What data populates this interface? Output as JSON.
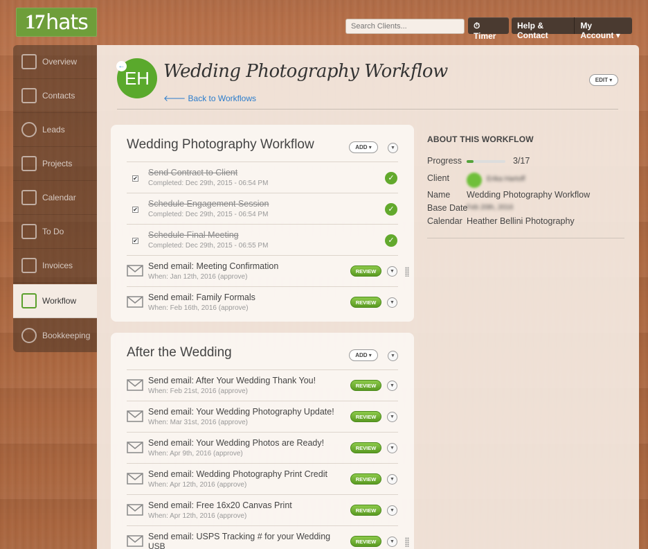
{
  "brand": {
    "logo_num": "17",
    "logo_text": "hats"
  },
  "header": {
    "search_placeholder": "Search Clients...",
    "timer_label": "Timer",
    "help_label": "Help & Contact",
    "account_label": "My Account"
  },
  "sidebar": {
    "items": [
      {
        "label": "Overview",
        "icon": "chart-icon"
      },
      {
        "label": "Contacts",
        "icon": "contacts-icon"
      },
      {
        "label": "Leads",
        "icon": "lead-icon"
      },
      {
        "label": "Projects",
        "icon": "projects-icon"
      },
      {
        "label": "Calendar",
        "icon": "calendar-icon"
      },
      {
        "label": "To Do",
        "icon": "todo-icon"
      },
      {
        "label": "Invoices",
        "icon": "invoice-icon"
      },
      {
        "label": "Workflow",
        "icon": "workflow-icon",
        "active": true
      },
      {
        "label": "Bookkeeping",
        "icon": "piggybank-icon"
      }
    ]
  },
  "page": {
    "avatar_initials": "EH",
    "title": "Wedding Photography Workflow",
    "back_link": "Back to Workflows",
    "edit_label": "EDIT"
  },
  "workflows": [
    {
      "title": "Wedding Photography Workflow",
      "add_label": "ADD",
      "rows": [
        {
          "type": "task",
          "done": true,
          "title": "Send Contract to Client",
          "sub": "Completed: Dec 29th, 2015 - 06:54 PM"
        },
        {
          "type": "task",
          "done": true,
          "title": "Schedule Engagement Session",
          "sub": "Completed: Dec 29th, 2015 - 06:54 PM"
        },
        {
          "type": "task",
          "done": true,
          "title": "Schedule Final Meeting",
          "sub": "Completed: Dec 29th, 2015 - 06:55 PM"
        },
        {
          "type": "email",
          "title": "Send email: Meeting Confirmation",
          "sub": "When: Jan 12th, 2016 (approve)",
          "action": "REVIEW"
        },
        {
          "type": "email",
          "title": "Send email: Family Formals",
          "sub": "When: Feb 16th, 2016 (approve)",
          "action": "REVIEW"
        }
      ]
    },
    {
      "title": "After the Wedding",
      "add_label": "ADD",
      "rows": [
        {
          "type": "email",
          "title": "Send email: After Your Wedding Thank You!",
          "sub": "When: Feb 21st, 2016 (approve)",
          "action": "REVIEW"
        },
        {
          "type": "email",
          "title": "Send email: Your Wedding Photography Update!",
          "sub": "When: Mar 31st, 2016 (approve)",
          "action": "REVIEW"
        },
        {
          "type": "email",
          "title": "Send email: Your Wedding Photos are Ready!",
          "sub": "When: Apr 9th, 2016 (approve)",
          "action": "REVIEW"
        },
        {
          "type": "email",
          "title": "Send email: Wedding Photography Print Credit",
          "sub": "When: Apr 12th, 2016 (approve)",
          "action": "REVIEW"
        },
        {
          "type": "email",
          "title": "Send email: Free 16x20 Canvas Print",
          "sub": "When: Apr 12th, 2016 (approve)",
          "action": "REVIEW"
        },
        {
          "type": "email",
          "title": "Send email: USPS Tracking # for your Wedding",
          "sub": "USB",
          "action": "REVIEW"
        }
      ]
    }
  ],
  "about": {
    "heading": "ABOUT THIS WORKFLOW",
    "progress_label": "Progress",
    "progress_text": "3/17",
    "progress_fraction": 0.176,
    "client_label": "Client",
    "client_value": "Erika Hartoff",
    "name_label": "Name",
    "name_value": "Wedding Photography Workflow",
    "base_date_label": "Base Date",
    "base_date_value": "Feb 20th, 2016",
    "calendar_label": "Calendar",
    "calendar_value": "Heather Bellini Photography"
  },
  "colors": {
    "accent_green": "#5aa92c",
    "link_blue": "#2a7ccc",
    "wood": "#ad6840"
  }
}
